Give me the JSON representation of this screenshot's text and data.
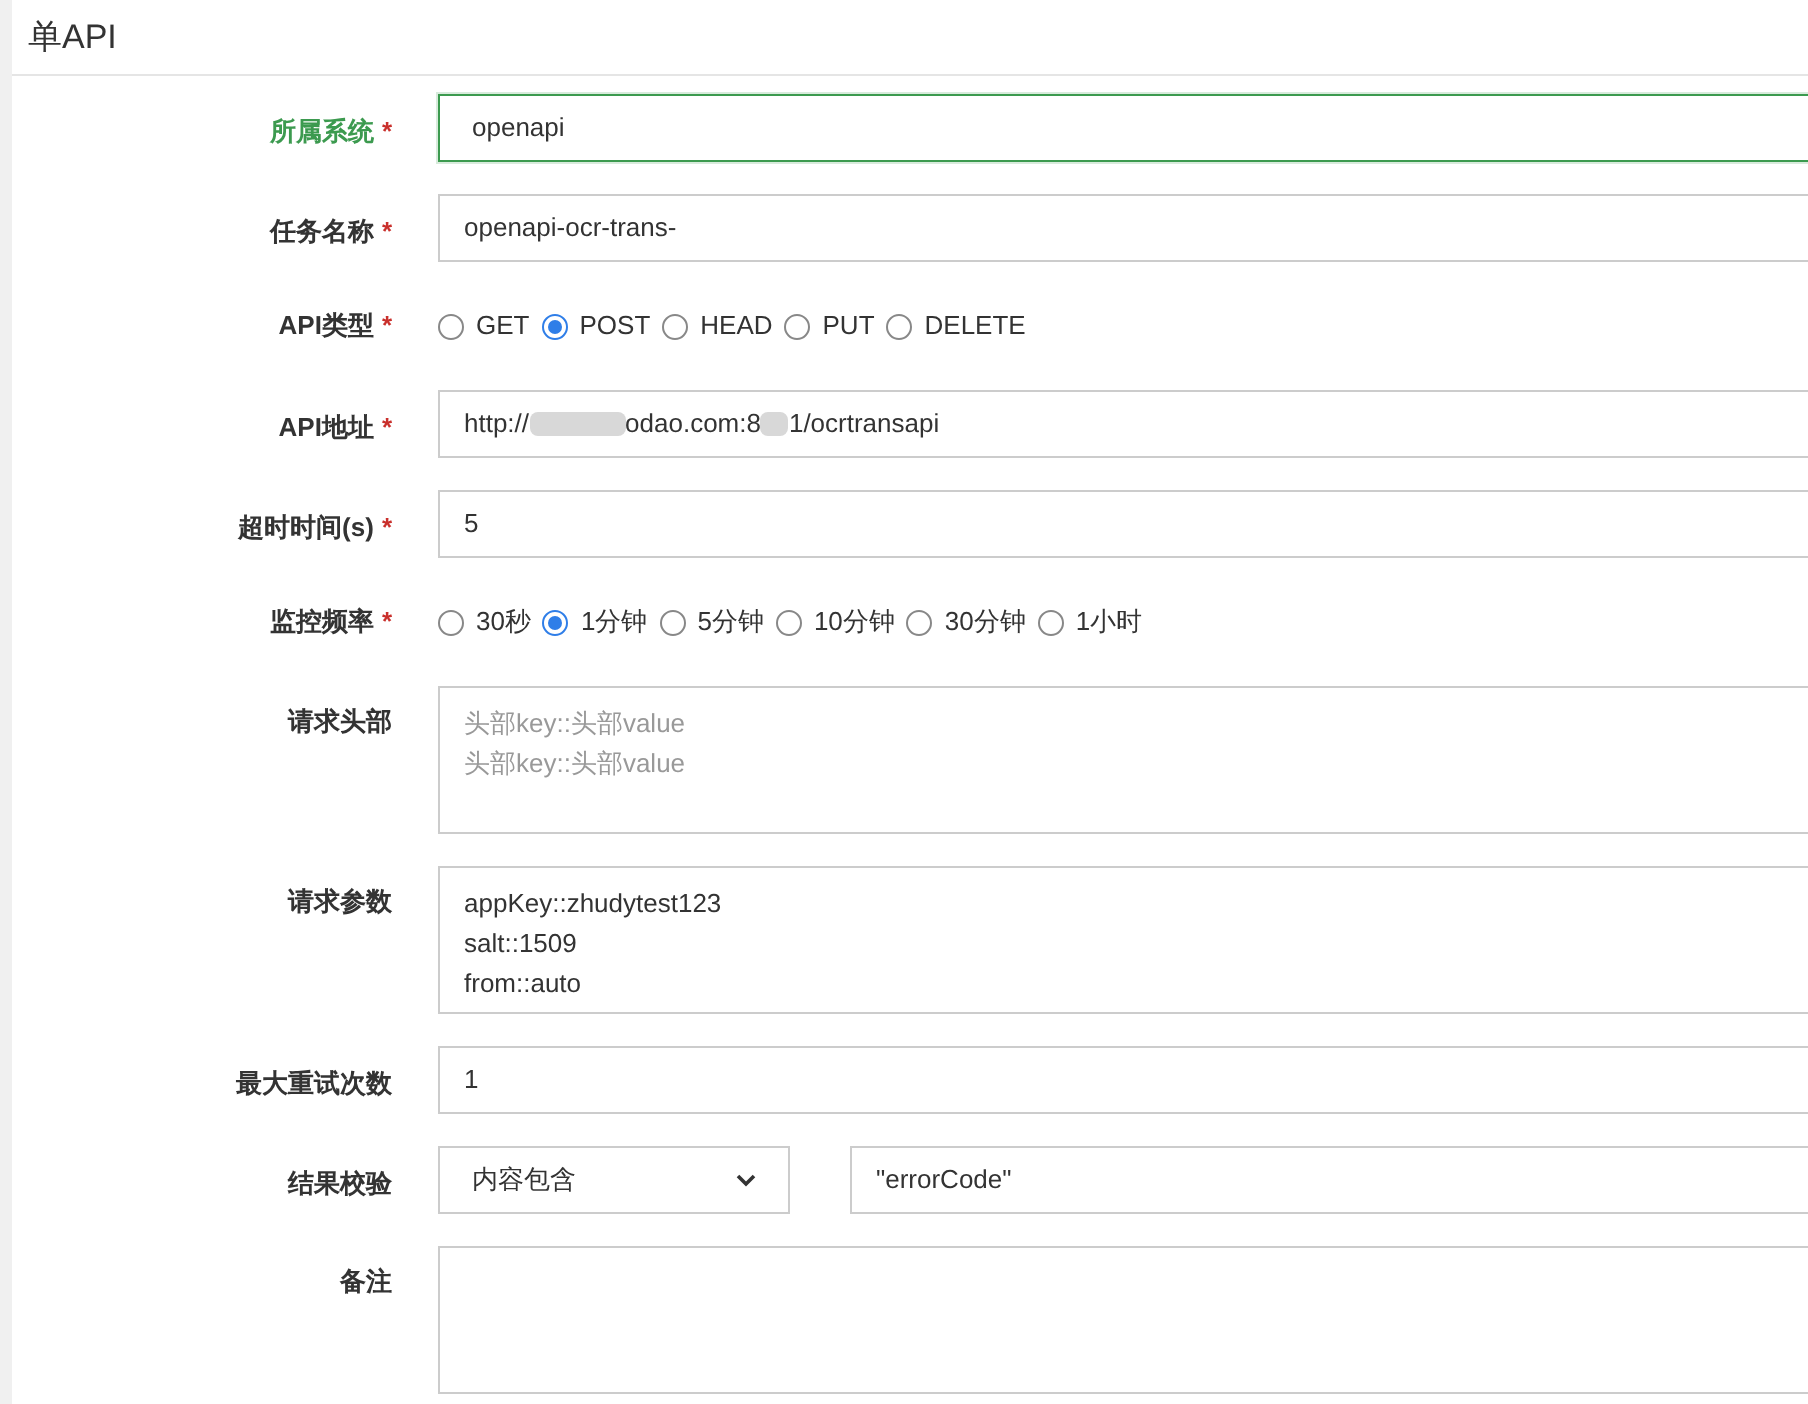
{
  "title": "单API",
  "fields": [
    {
      "kind": "input",
      "label": "所属系统",
      "mark": "*",
      "focused": true,
      "value": "openapi"
    },
    {
      "kind": "input",
      "label": "任务名称",
      "mark": "*",
      "focused": false,
      "value": "openapi-ocr-trans-"
    },
    {
      "kind": "radio",
      "label": "API类型",
      "mark": "*",
      "options": [
        {
          "label": "GET",
          "selected": false
        },
        {
          "label": "POST",
          "selected": true
        },
        {
          "label": "HEAD",
          "selected": false
        },
        {
          "label": "PUT",
          "selected": false
        },
        {
          "label": "DELETE",
          "selected": false
        }
      ]
    },
    {
      "kind": "masked",
      "label": "API地址",
      "mark": "*",
      "parts": [
        "http://",
        "odao.com:8",
        "1/ocrtransapi"
      ]
    },
    {
      "kind": "input",
      "label": "超时时间(s)",
      "mark": "*",
      "focused": false,
      "value": "5"
    },
    {
      "kind": "radio",
      "label": "监控频率",
      "mark": "*",
      "options": [
        {
          "label": "30秒",
          "selected": false
        },
        {
          "label": "1分钟",
          "selected": true
        },
        {
          "label": "5分钟",
          "selected": false
        },
        {
          "label": "10分钟",
          "selected": false
        },
        {
          "label": "30分钟",
          "selected": false
        },
        {
          "label": "1小时",
          "selected": false
        }
      ]
    },
    {
      "kind": "textarea",
      "label": "请求头部",
      "placeholder": [
        "头部key::头部value",
        "头部key::头部value"
      ]
    },
    {
      "kind": "textarea",
      "label": "请求参数",
      "value": [
        "appKey::zhudytest123",
        "salt::1509",
        "from::auto"
      ]
    },
    {
      "kind": "input",
      "label": "最大重试次数",
      "focused": false,
      "value": "1"
    },
    {
      "kind": "select",
      "label": "结果校验",
      "value": "内容包含",
      "extra": "\"errorCode\""
    },
    {
      "kind": "textarea",
      "label": "备注"
    }
  ]
}
